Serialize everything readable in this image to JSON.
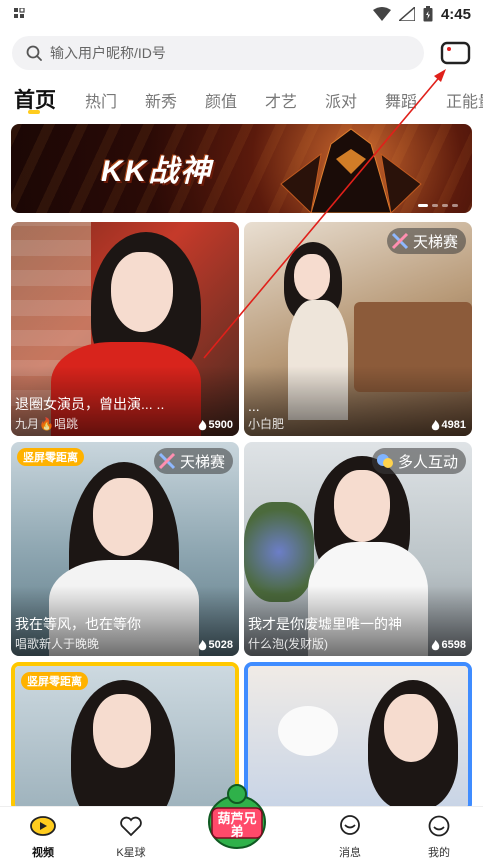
{
  "status_bar": {
    "time": "4:45"
  },
  "search": {
    "placeholder": "输入用户昵称/ID号"
  },
  "tabs": [
    {
      "label": "首页",
      "active": true
    },
    {
      "label": "热门"
    },
    {
      "label": "新秀"
    },
    {
      "label": "颜值"
    },
    {
      "label": "才艺"
    },
    {
      "label": "派对"
    },
    {
      "label": "舞蹈"
    },
    {
      "label": "正能量"
    }
  ],
  "banner": {
    "title": "KK战神"
  },
  "cards": [
    {
      "title": "退圈女演员，曾出演... ..",
      "subtitle": "九月🔥唱跳",
      "count": "5900",
      "badge": "",
      "tag": ""
    },
    {
      "title": "...",
      "subtitle": "小白肥",
      "count": "4981",
      "badge": "天梯赛",
      "tag": ""
    },
    {
      "title": "我在等风，也在等你",
      "subtitle": "唱歌新人于晚晚",
      "count": "5028",
      "badge": "天梯赛",
      "tag": "竖屏零距离"
    },
    {
      "title": "我才是你废墟里唯一的神",
      "subtitle": "什么泡(发财版)",
      "count": "6598",
      "badge": "多人互动",
      "tag": ""
    },
    {
      "title": "",
      "subtitle": "",
      "count": "",
      "badge": "",
      "tag": "竖屏零距离"
    },
    {
      "title": "",
      "subtitle": "",
      "count": "",
      "badge": "",
      "tag": ""
    }
  ],
  "bottom_nav": [
    {
      "label": "视频",
      "icon": "video-icon",
      "active": true
    },
    {
      "label": "K星球",
      "icon": "planet-heart-icon"
    },
    {
      "label": "消息",
      "icon": "message-icon"
    },
    {
      "label": "我的",
      "icon": "profile-icon"
    }
  ],
  "center_logo": {
    "text": "葫芦兄弟"
  },
  "colors": {
    "accent": "#ffcc1e",
    "tag": "#ffb200",
    "card_border_yellow": "#ffc800",
    "card_border_blue": "#3f8cff",
    "annotation_arrow": "#e0201a"
  }
}
